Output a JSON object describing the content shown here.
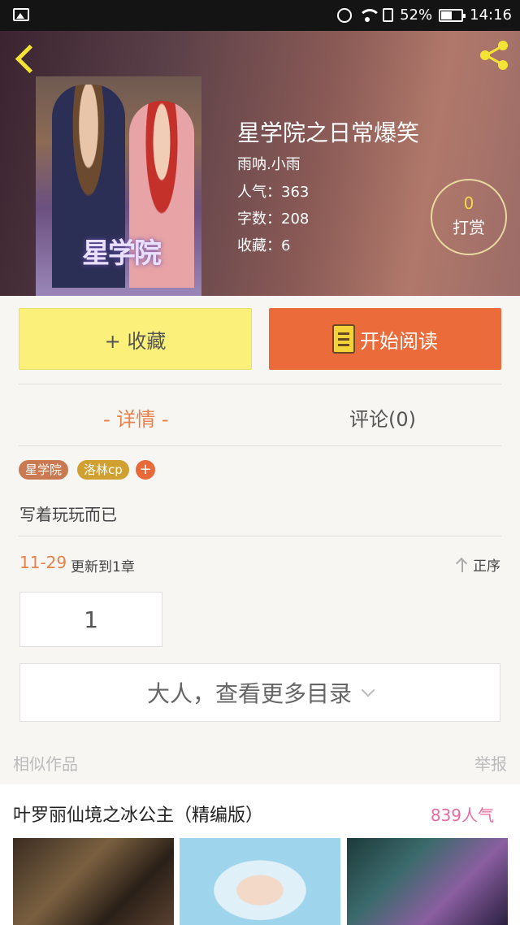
{
  "status": {
    "battery": "52%",
    "time": "14:16"
  },
  "book": {
    "title": "星学院之日常爆笑",
    "author": "雨呐.小雨",
    "popularity": "人气：363",
    "words": "字数：208",
    "favorites": "收藏：6",
    "tip_count": "0",
    "tip_label": "打赏",
    "cover_logo": "星学院"
  },
  "actions": {
    "favorite": "+ 收藏",
    "read": "开始阅读"
  },
  "tabs": {
    "detail": "- 详情 -",
    "comments": "评论(0)"
  },
  "tags": [
    "星学院",
    "洛林cp"
  ],
  "tag_add": "+",
  "description": "写着玩玩而已",
  "update": {
    "date": "11-29",
    "text": "更新到1章",
    "sort": "正序"
  },
  "chapters": [
    "1"
  ],
  "more_label": "大人，查看更多目录",
  "similar": {
    "label": "相似作品",
    "report": "举报"
  },
  "recommend": {
    "title": "叶罗丽仙境之冰公主（精编版）",
    "popularity": "839人气"
  },
  "colors": {
    "accent": "#ec6b3a",
    "favorite_btn": "#fbf17a",
    "detail_tab": "#e8814a",
    "pop_pink": "#e86aa0"
  }
}
